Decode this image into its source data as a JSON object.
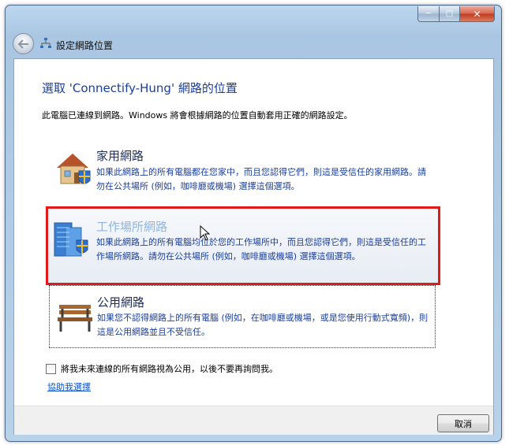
{
  "window": {
    "title": "設定網路位置",
    "controls": {
      "minimize": "─",
      "maximize": "□",
      "close": "✕"
    },
    "back_icon": "back-arrow-icon"
  },
  "main": {
    "heading": "選取 'Connectify-Hung' 網路的位置",
    "description": "此電腦已連線到網路。Windows 將會根據網路的位置自動套用正確的網路設定。",
    "options": [
      {
        "title": "家用網路",
        "description": "如果此網路上的所有電腦都在您家中，而且您認得它們，則這是受信任的家用網路。請勿在公共場所 (例如，咖啡廳或機場) 選擇這個選項。",
        "icon": "home-network-icon"
      },
      {
        "title": "工作場所網路",
        "description": "如果此網路上的所有電腦均位於您的工作場所中，而且您認得它們，則這是受信任的工作場所網路。請勿在公共場所 (例如，咖啡廳或機場) 選擇這個選項。",
        "icon": "work-network-icon",
        "highlighted": true
      },
      {
        "title": "公用網路",
        "description": "如果您不認得網路上的所有電腦 (例如，在咖啡廳或機場，或是您使用行動式寬頻)，則這是公用網路並且不受信任。",
        "icon": "public-network-icon"
      }
    ],
    "checkbox_label": "將我未來連線的所有網路視為公用，以後不要再詢問我。",
    "checkbox_checked": false,
    "help_link": "協助我選擇"
  },
  "footer": {
    "cancel_label": "取消"
  },
  "colors": {
    "heading": "#1a3e9b",
    "link": "#0b53c5",
    "highlight_border": "#e01919"
  }
}
